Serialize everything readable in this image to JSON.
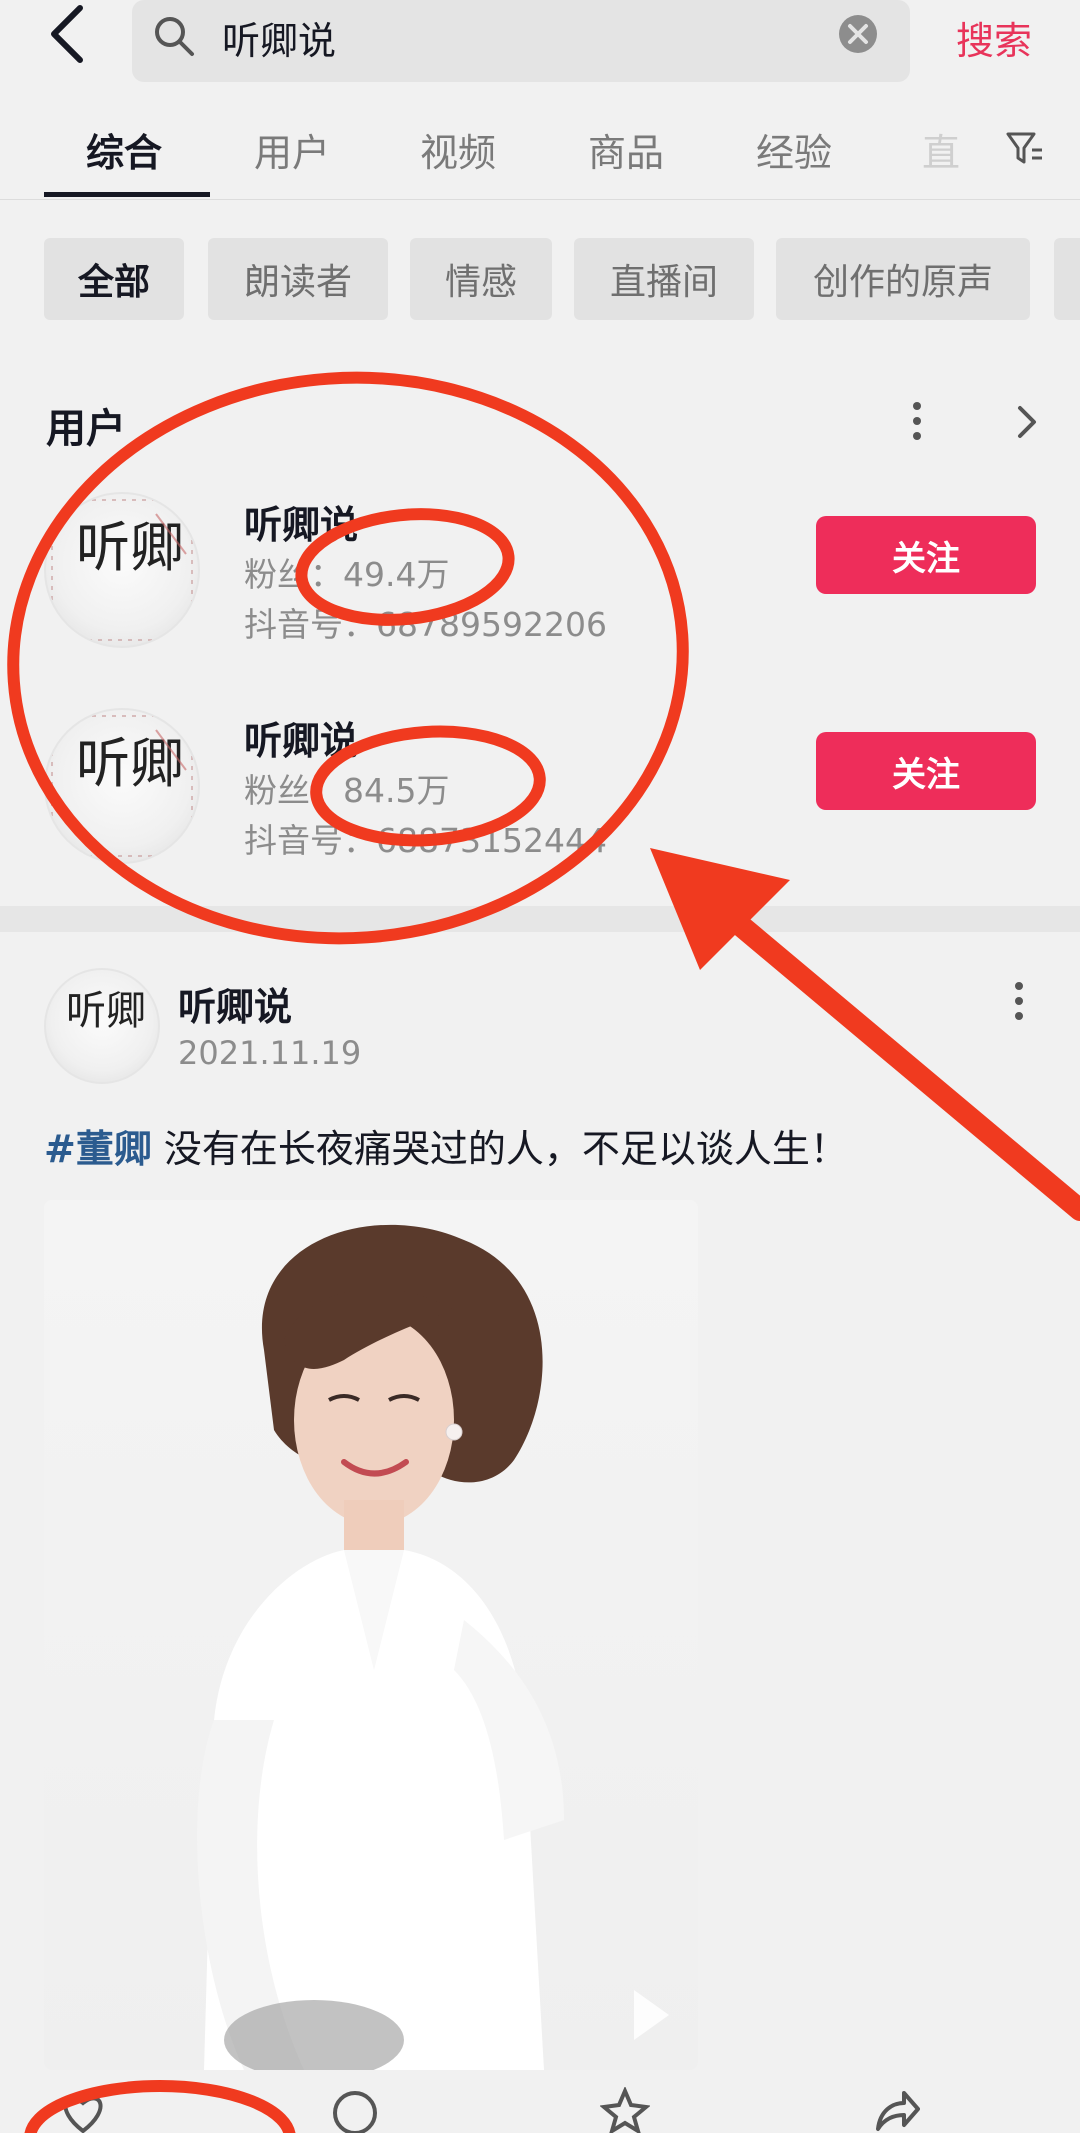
{
  "search": {
    "query": "听卿说",
    "button_label": "搜索"
  },
  "tabs": [
    {
      "label": "综合",
      "active": true
    },
    {
      "label": "用户"
    },
    {
      "label": "视频"
    },
    {
      "label": "商品"
    },
    {
      "label": "经验"
    },
    {
      "label": "直"
    }
  ],
  "chips": [
    {
      "label": "全部",
      "active": true
    },
    {
      "label": "朗读者"
    },
    {
      "label": "情感"
    },
    {
      "label": "直播间"
    },
    {
      "label": "创作的原声"
    }
  ],
  "users_section": {
    "title": "用户",
    "users": [
      {
        "name": "听卿说",
        "fans": "粉丝：49.4万",
        "douyin_id": "抖音号：68789592206",
        "follow_label": "关注",
        "avatar_text": "听卿"
      },
      {
        "name": "听卿说",
        "fans": "粉丝：84.5万",
        "douyin_id": "抖音号：68873152444",
        "follow_label": "关注",
        "avatar_text": "听卿"
      }
    ]
  },
  "post": {
    "author": "听卿说",
    "date": "2021.11.19",
    "hashtag": "#董卿",
    "caption": " 没有在长夜痛哭过的人，不足以谈人生！",
    "avatar_text": "听卿"
  },
  "colors": {
    "accent": "#ee2d5a",
    "search_button": "#e8345a",
    "hashtag": "#2b5b8f",
    "annotation_red": "#f03a1f"
  }
}
